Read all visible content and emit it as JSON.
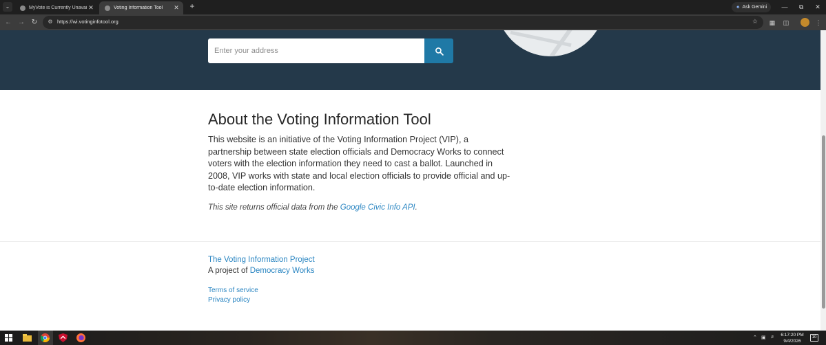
{
  "browser": {
    "tabs": [
      {
        "title": "MyVote is Currently Unavailabl",
        "active": false
      },
      {
        "title": "Voting Information Tool",
        "active": true
      }
    ],
    "new_tab_icon": "plus-icon",
    "ask_gemini_label": "Ask Gemini",
    "url": "https://wi.votinginfotool.org"
  },
  "search": {
    "placeholder": "Enter your address",
    "button_icon": "search-icon"
  },
  "about": {
    "title": "About the Voting Information Tool",
    "body": "This website is an initiative of the Voting Information Project (VIP), a partnership between state election officials and Democracy Works to connect voters with the election information they need to cast a ballot. Launched in 2008, VIP works with state and local election officials to provide official and up-to-date election information.",
    "note_prefix": "This site returns official data from the ",
    "note_link": "Google Civic Info API",
    "note_suffix": "."
  },
  "footer": {
    "vip_link": "The Voting Information Project",
    "project_prefix": "A project of ",
    "project_link": "Democracy Works",
    "terms": "Terms of service",
    "privacy": "Privacy policy"
  },
  "taskbar": {
    "time": "6:17:20 PM",
    "date": "9/4/2026",
    "notification_count": "10"
  },
  "colors": {
    "hero_bg": "#24394a",
    "accent": "#1f79a6",
    "link": "#2b86c2"
  }
}
